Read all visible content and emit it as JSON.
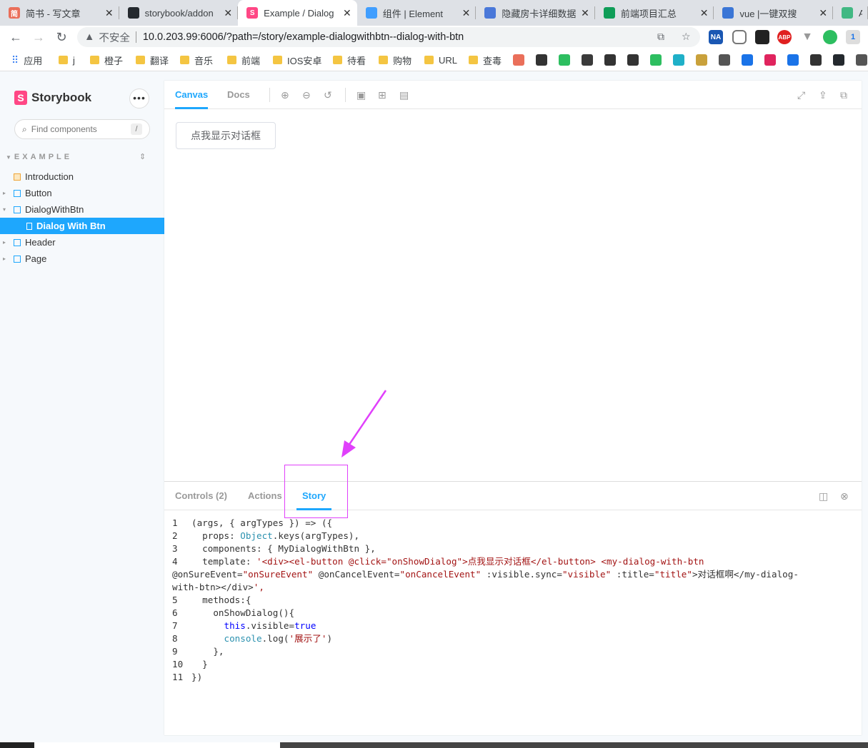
{
  "browser": {
    "tabs": [
      {
        "title": "简书 - 写文章",
        "favicon": "jianshu-icon",
        "color": "#ea6f5a",
        "glyph": "简"
      },
      {
        "title": "storybook/addon",
        "favicon": "github-icon",
        "color": "#24292e",
        "glyph": ""
      },
      {
        "title": "Example / Dialog",
        "favicon": "storybook-icon",
        "color": "#ff4785",
        "glyph": "S"
      },
      {
        "title": "组件 | Element",
        "favicon": "element-icon",
        "color": "#409eff",
        "glyph": ""
      },
      {
        "title": "隐藏房卡详细数据",
        "favicon": "confluence-icon",
        "color": "#4a78d9",
        "glyph": ""
      },
      {
        "title": "前端项目汇总",
        "favicon": "sheets-icon",
        "color": "#0f9d58",
        "glyph": ""
      },
      {
        "title": "vue |一键双搜",
        "favicon": "search-icon",
        "color": "#3b76d6",
        "glyph": ""
      },
      {
        "title": "AP",
        "favicon": "vue-icon",
        "color": "#41b883",
        "glyph": ""
      }
    ],
    "active_tab": 2,
    "address": {
      "insecure_label": "不安全",
      "url": "10.0.203.99:6006/?path=/story/example-dialogwithbtn--dialog-with-btn"
    },
    "bookmarks": [
      "应用",
      "j",
      "橙子",
      "翻译",
      "音乐",
      "前端",
      "IOS安卓",
      "待看",
      "购物",
      "URL",
      "查毒"
    ]
  },
  "storybook": {
    "brand": "Storybook",
    "more_label": "•••",
    "search_placeholder": "Find components",
    "search_shortcut": "/",
    "section_title": "EXAMPLE",
    "nav": [
      {
        "label": "Introduction",
        "type": "doc"
      },
      {
        "label": "Button",
        "type": "component"
      },
      {
        "label": "DialogWithBtn",
        "type": "component",
        "expanded": true
      },
      {
        "label": "Dialog With Btn",
        "type": "story",
        "selected": true
      },
      {
        "label": "Header",
        "type": "component"
      },
      {
        "label": "Page",
        "type": "component"
      }
    ],
    "toolbar": {
      "tabs": [
        "Canvas",
        "Docs"
      ],
      "active": "Canvas"
    },
    "preview": {
      "button_label": "点我显示对话框"
    },
    "addons": {
      "tabs": [
        "Controls (2)",
        "Actions",
        "Story"
      ],
      "active": "Story"
    },
    "code_lines": [
      "1",
      "2",
      "3",
      "4",
      "",
      "",
      "5",
      "6",
      "7",
      "8",
      "9",
      "10",
      "11"
    ],
    "code": [
      "(args, { argTypes }) => ({",
      "  props: Object.keys(argTypes),",
      "  components: { MyDialogWithBtn },",
      "  template: '<div><el-button @click=\"onShowDialog\">点我显示对话框</el-button> <my-dialog-with-btn",
      "@onSureEvent=\"onSureEvent\" @onCancelEvent=\"onCancelEvent\" :visible.sync=\"visible\" :title=\"title\">对话框啊</my-dialog-",
      "with-btn></div>',",
      "  methods:{",
      "    onShowDialog(){",
      "      this.visible=true",
      "      console.log('展示了')",
      "    },",
      "  }",
      "})"
    ]
  },
  "colors": {
    "accent": "#1ea7fd",
    "storybook_pink": "#ff4785",
    "annotation": "#e040fb"
  }
}
